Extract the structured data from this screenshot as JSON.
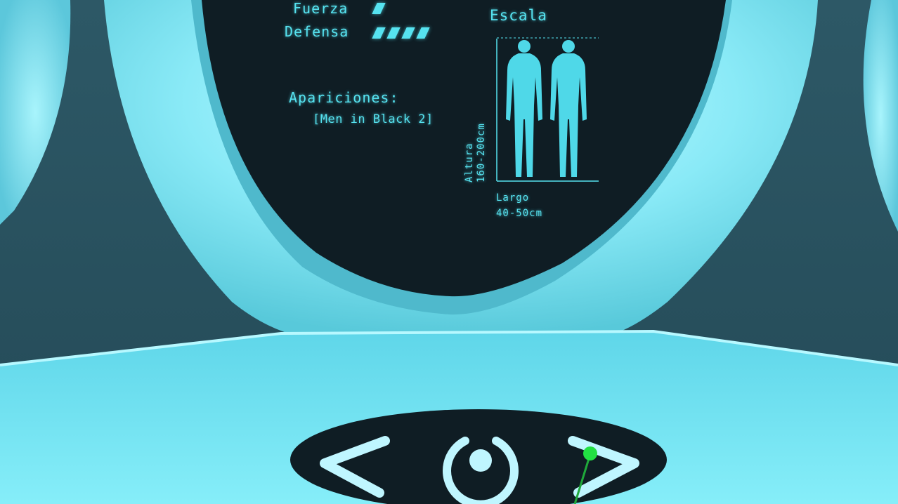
{
  "stats": {
    "strength": {
      "label": "Fuerza",
      "level": 1
    },
    "defense": {
      "label": "Defensa",
      "level": 4
    }
  },
  "appearances": {
    "label": "Apariciones:",
    "value": "[Men in Black 2]"
  },
  "scale": {
    "title": "Escala",
    "height_label": "Altura",
    "height_value": "160-200cm",
    "length_label": "Largo",
    "length_value": "40-50cm"
  },
  "controls": {
    "prev_icon": "chevron-left-icon",
    "select_icon": "ring-button-icon",
    "next_icon": "chevron-right-icon"
  },
  "colors": {
    "hud_text": "#56e3f0",
    "screen": "#0f1d24",
    "frame": "#7fe6f5",
    "pointer": "#22e043"
  }
}
